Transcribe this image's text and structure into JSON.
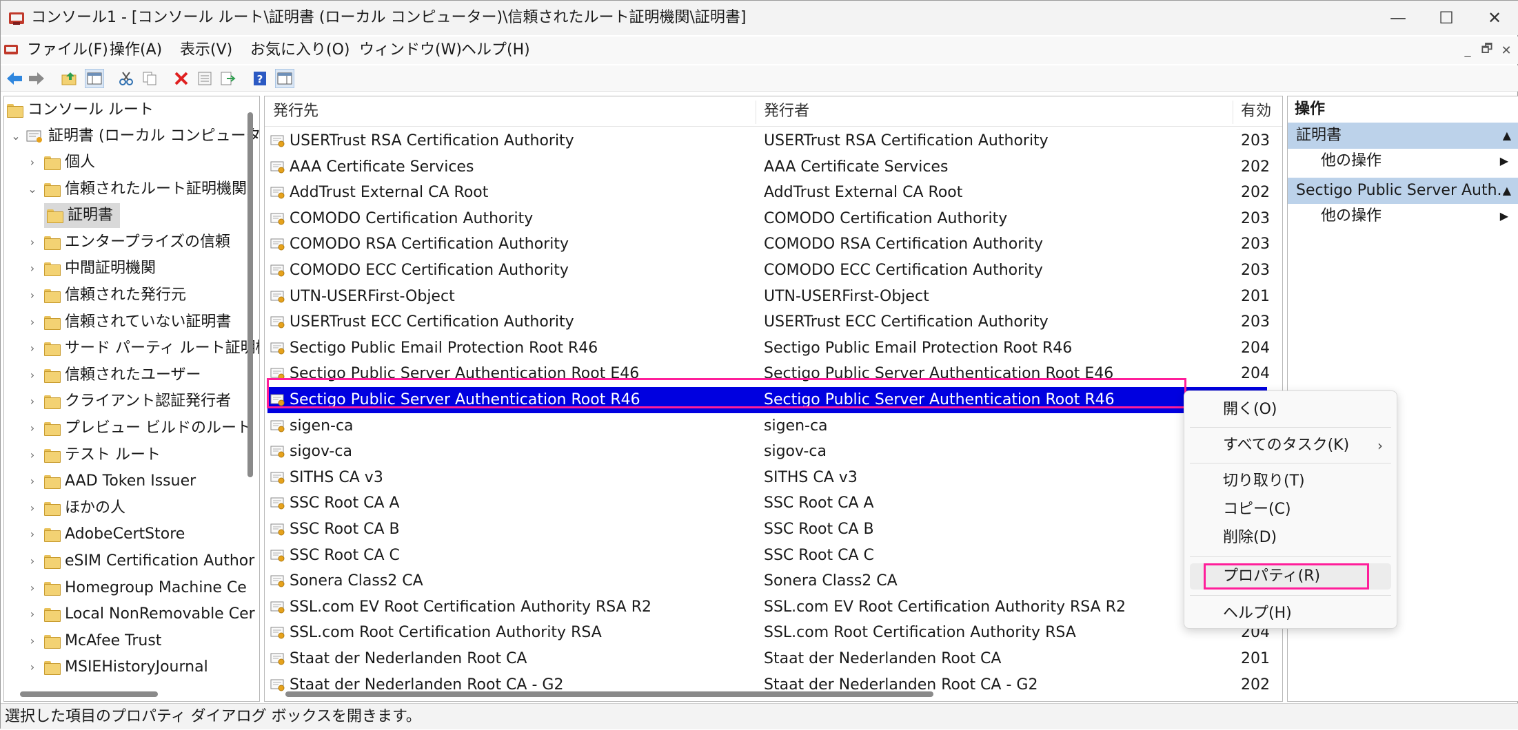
{
  "window": {
    "title": "コンソール1 - [コンソール ルート\\証明書 (ローカル コンピューター)\\信頼されたルート証明機関\\証明書]",
    "minimize": "—",
    "maximize": "☐",
    "close": "✕"
  },
  "menu": {
    "items": [
      "ファイル(F)",
      "操作(A)",
      "表示(V)",
      "お気に入り(O)",
      "ウィンドウ(W)",
      "ヘルプ(H)"
    ],
    "mdi": [
      "_",
      "🗗",
      "✕"
    ]
  },
  "toolbar": {
    "icons": [
      "back-arrow-icon",
      "forward-arrow-icon",
      "up-folder-icon",
      "show-hide-tree-icon",
      "cut-icon",
      "copy-icon",
      "delete-icon",
      "properties-icon",
      "export-icon",
      "help-icon",
      "action-pane-icon"
    ]
  },
  "tree": {
    "root": "コンソール ルート",
    "store": "証明書 (ローカル コンピューター)",
    "items": [
      {
        "label": "個人",
        "expander": "›"
      },
      {
        "label": "信頼されたルート証明機関",
        "expander": "⌄"
      },
      {
        "label": "証明書",
        "expander": ""
      },
      {
        "label": "エンタープライズの信頼",
        "expander": "›"
      },
      {
        "label": "中間証明機関",
        "expander": "›"
      },
      {
        "label": "信頼された発行元",
        "expander": "›"
      },
      {
        "label": "信頼されていない証明書",
        "expander": "›"
      },
      {
        "label": "サード パーティ ルート証明機",
        "expander": "›"
      },
      {
        "label": "信頼されたユーザー",
        "expander": "›"
      },
      {
        "label": "クライアント認証発行者",
        "expander": "›"
      },
      {
        "label": "プレビュー ビルドのルート",
        "expander": "›"
      },
      {
        "label": "テスト ルート",
        "expander": "›"
      },
      {
        "label": "AAD Token Issuer",
        "expander": "›"
      },
      {
        "label": "ほかの人",
        "expander": "›"
      },
      {
        "label": "AdobeCertStore",
        "expander": "›"
      },
      {
        "label": "eSIM Certification Author",
        "expander": "›"
      },
      {
        "label": "Homegroup Machine Ce",
        "expander": "›"
      },
      {
        "label": "Local NonRemovable Cer",
        "expander": "›"
      },
      {
        "label": "McAfee Trust",
        "expander": "›"
      },
      {
        "label": "MSIEHistoryJournal",
        "expander": "›"
      }
    ]
  },
  "list": {
    "headers": [
      "発行先",
      "発行者",
      "有効"
    ],
    "rows": [
      {
        "to": "USERTrust RSA Certification Authority",
        "by": "USERTrust RSA Certification Authority",
        "exp": "203"
      },
      {
        "to": "AAA Certificate Services",
        "by": "AAA Certificate Services",
        "exp": "202"
      },
      {
        "to": "AddTrust External CA Root",
        "by": "AddTrust External CA Root",
        "exp": "202"
      },
      {
        "to": "COMODO Certification Authority",
        "by": "COMODO Certification Authority",
        "exp": "203"
      },
      {
        "to": "COMODO RSA Certification Authority",
        "by": "COMODO RSA Certification Authority",
        "exp": "203"
      },
      {
        "to": "COMODO ECC Certification Authority",
        "by": "COMODO ECC Certification Authority",
        "exp": "203"
      },
      {
        "to": "UTN-USERFirst-Object",
        "by": "UTN-USERFirst-Object",
        "exp": "201"
      },
      {
        "to": "USERTrust ECC Certification Authority",
        "by": "USERTrust ECC Certification Authority",
        "exp": "203"
      },
      {
        "to": "Sectigo Public Email Protection Root R46",
        "by": "Sectigo Public Email Protection Root R46",
        "exp": "204"
      },
      {
        "to": "Sectigo Public Server Authentication Root E46",
        "by": "Sectigo Public Server Authentication Root E46",
        "exp": "204"
      },
      {
        "to": "Sectigo Public Server Authentication Root R46",
        "by": "Sectigo Public Server Authentication Root R46",
        "exp": ""
      },
      {
        "to": "sigen-ca",
        "by": "sigen-ca",
        "exp": ""
      },
      {
        "to": "sigov-ca",
        "by": "sigov-ca",
        "exp": ""
      },
      {
        "to": "SITHS CA v3",
        "by": "SITHS CA v3",
        "exp": ""
      },
      {
        "to": "SSC Root CA A",
        "by": "SSC Root CA A",
        "exp": ""
      },
      {
        "to": "SSC Root CA B",
        "by": "SSC Root CA B",
        "exp": ""
      },
      {
        "to": "SSC Root CA C",
        "by": "SSC Root CA C",
        "exp": ""
      },
      {
        "to": "Sonera Class2 CA",
        "by": "Sonera Class2 CA",
        "exp": ""
      },
      {
        "to": "SSL.com EV Root Certification Authority RSA R2",
        "by": "SSL.com EV Root Certification Authority RSA R2",
        "exp": ""
      },
      {
        "to": "SSL.com Root Certification Authority RSA",
        "by": "SSL.com Root Certification Authority RSA",
        "exp": "204"
      },
      {
        "to": "Staat der Nederlanden Root CA",
        "by": "Staat der Nederlanden Root CA",
        "exp": "201"
      },
      {
        "to": "Staat der Nederlanden Root CA - G2",
        "by": "Staat der Nederlanden Root CA - G2",
        "exp": "202"
      }
    ]
  },
  "actions": {
    "title": "操作",
    "section1": "証明書",
    "section2": "Sectigo Public Server Auth...",
    "more1": "他の操作",
    "more2": "他の操作"
  },
  "context_menu": {
    "open": "開く(O)",
    "all_tasks": "すべてのタスク(K)",
    "cut": "切り取り(T)",
    "copy": "コピー(C)",
    "delete": "削除(D)",
    "properties": "プロパティ(R)",
    "help": "ヘルプ(H)"
  },
  "status": {
    "text": "選択した項目のプロパティ ダイアログ ボックスを開きます。"
  },
  "colors": {
    "selection": "#0000e0",
    "highlight_outline": "#ff1e9a",
    "action_section": "#bcd2ea"
  }
}
